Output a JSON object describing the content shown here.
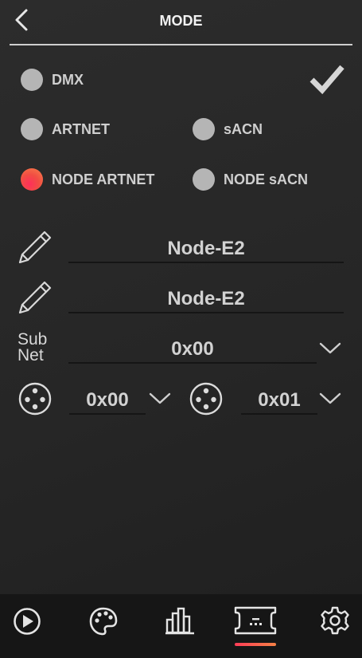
{
  "header": {
    "title": "MODE"
  },
  "modes": [
    {
      "label": "DMX",
      "selected": false
    },
    {
      "label": "ARTNET",
      "selected": false
    },
    {
      "label": "sACN",
      "selected": false
    },
    {
      "label": "NODE ARTNET",
      "selected": true
    },
    {
      "label": "NODE sACN",
      "selected": false
    }
  ],
  "fields": {
    "name1": "Node-E2",
    "name2": "Node-E2",
    "subnet_label_line1": "Sub",
    "subnet_label_line2": "Net",
    "subnet_value": "0x00",
    "universe1_value": "0x00",
    "universe2_value": "0x01"
  },
  "colors": {
    "accent_start": "#ff2f5a",
    "accent_end": "#f6824a",
    "background": "#282828",
    "nav_background": "#161616"
  },
  "nav": {
    "items": [
      "play-icon",
      "palette-icon",
      "bar-chart-icon",
      "node-icon",
      "settings-icon"
    ],
    "active": "node-icon"
  }
}
